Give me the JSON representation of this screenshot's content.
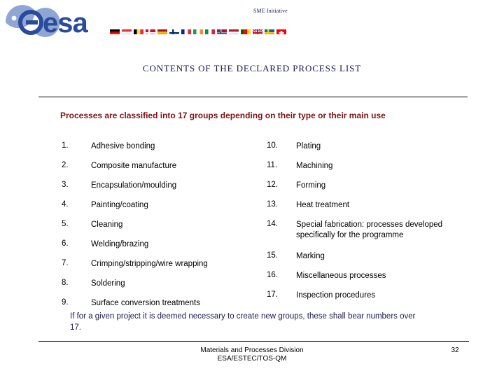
{
  "header": {
    "logo_alt": "esa",
    "logo_wordmark": "esa",
    "programme_label": "SME Initiative",
    "flags": [
      {
        "name": "germany",
        "colors": [
          "#000000",
          "#DD0000",
          "#FFCE00"
        ],
        "orientation": "horizontal"
      },
      {
        "name": "austria",
        "colors": [
          "#ED2939",
          "#FFFFFF",
          "#ED2939"
        ],
        "orientation": "horizontal"
      },
      {
        "name": "belgium",
        "colors": [
          "#000000",
          "#FAE042",
          "#ED2939"
        ],
        "orientation": "vertical"
      },
      {
        "name": "denmark",
        "colors": [
          "#C8102E",
          "#FFFFFF"
        ],
        "orientation": "nordic-cross"
      },
      {
        "name": "spain",
        "colors": [
          "#AA151B",
          "#F1BF00",
          "#AA151B"
        ],
        "orientation": "horizontal"
      },
      {
        "name": "finland",
        "colors": [
          "#FFFFFF",
          "#002F6C"
        ],
        "orientation": "nordic-cross"
      },
      {
        "name": "france",
        "colors": [
          "#002395",
          "#FFFFFF",
          "#ED2939"
        ],
        "orientation": "vertical"
      },
      {
        "name": "ireland",
        "colors": [
          "#169B62",
          "#FFFFFF",
          "#FF883E"
        ],
        "orientation": "vertical"
      },
      {
        "name": "italy",
        "colors": [
          "#009246",
          "#FFFFFF",
          "#CE2B37"
        ],
        "orientation": "vertical"
      },
      {
        "name": "norway",
        "colors": [
          "#BA0C2F",
          "#FFFFFF",
          "#00205B"
        ],
        "orientation": "nordic-cross"
      },
      {
        "name": "netherlands",
        "colors": [
          "#AE1C28",
          "#FFFFFF",
          "#21468B"
        ],
        "orientation": "horizontal"
      },
      {
        "name": "portugal",
        "colors": [
          "#006600",
          "#FF0000",
          "#FFD700"
        ],
        "orientation": "vertical"
      },
      {
        "name": "united-kingdom",
        "colors": [
          "#012169",
          "#FFFFFF",
          "#C8102E"
        ],
        "orientation": "union-jack"
      },
      {
        "name": "sweden",
        "colors": [
          "#006AA7",
          "#FECC00"
        ],
        "orientation": "nordic-cross"
      },
      {
        "name": "switzerland",
        "colors": [
          "#FF0000",
          "#FFFFFF"
        ],
        "orientation": "cross"
      }
    ]
  },
  "title": "CONTENTS OF THE DECLARED PROCESS LIST",
  "subtitle": "Processes are classified into 17 groups depending on their type or their main use",
  "process_list": {
    "left_column": [
      {
        "number": "1.",
        "label": "Adhesive bonding"
      },
      {
        "number": "2.",
        "label": "Composite manufacture"
      },
      {
        "number": "3.",
        "label": "Encapsulation/moulding"
      },
      {
        "number": "4.",
        "label": "Painting/coating"
      },
      {
        "number": "5.",
        "label": "Cleaning"
      },
      {
        "number": "6.",
        "label": "Welding/brazing"
      },
      {
        "number": "7.",
        "label": "Crimping/stripping/wire wrapping"
      },
      {
        "number": "8.",
        "label": "Soldering"
      },
      {
        "number": "9.",
        "label": "Surface conversion treatments"
      }
    ],
    "right_column": [
      {
        "number": "10.",
        "label": "Plating"
      },
      {
        "number": "11.",
        "label": "Machining"
      },
      {
        "number": "12.",
        "label": "Forming"
      },
      {
        "number": "13.",
        "label": "Heat treatment"
      },
      {
        "number": "14.",
        "label": "Special fabrication: processes developed specifically for the programme"
      },
      {
        "number": "15.",
        "label": "Marking"
      },
      {
        "number": "16.",
        "label": "Miscellaneous processes"
      },
      {
        "number": "17.",
        "label": "Inspection procedures"
      }
    ]
  },
  "footnote": "If for a given project it is deemed necessary to create new groups, these shall bear numbers over 17.",
  "footer": {
    "line1": "Materials and Processes Division",
    "line2": "ESA/ESTEC/TOS-QM",
    "page_number": "32"
  },
  "colors": {
    "title": "#17174a",
    "subtitle": "#7b1414",
    "body": "#000000",
    "footnote": "#1a1a4e",
    "logo_blue": "#2a4b9b",
    "logo_light": "#8fa6d4"
  }
}
